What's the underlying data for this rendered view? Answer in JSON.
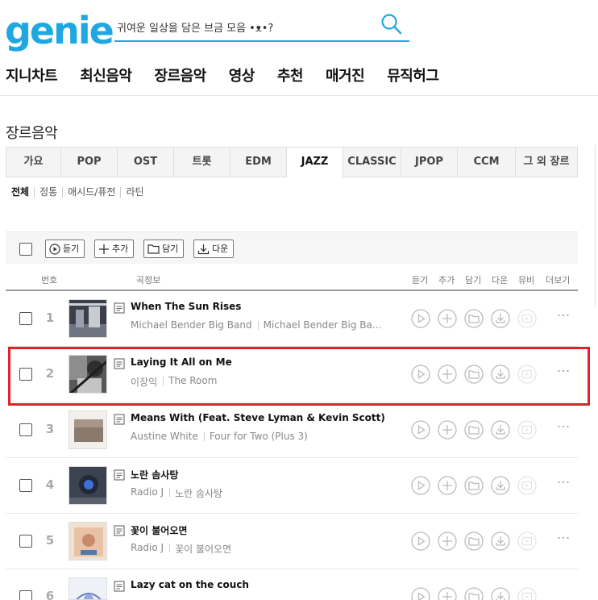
{
  "header": {
    "logo": "genie",
    "search_placeholder": "귀여운 일상을 담은 브금 모음 •ᴥ•?",
    "nav": [
      "지니차트",
      "최신음악",
      "장르음악",
      "영상",
      "추천",
      "매거진",
      "뮤직허그"
    ]
  },
  "page": {
    "title": "장르음악",
    "genre_tabs": [
      "가요",
      "POP",
      "OST",
      "트롯",
      "EDM",
      "JAZZ",
      "CLASSIC",
      "JPOP",
      "CCM",
      "그 외 장르"
    ],
    "active_tab": "JAZZ",
    "sub_tabs": [
      "전체",
      "정통",
      "애시드/퓨전",
      "라틴"
    ]
  },
  "toolbar": {
    "listen": "듣기",
    "add": "추가",
    "save": "담기",
    "download": "다운"
  },
  "list_header": {
    "no": "번호",
    "info": "곡정보",
    "listen": "듣기",
    "add": "추가",
    "save": "담기",
    "download": "다운",
    "mv": "뮤비",
    "more": "더보기"
  },
  "songs": [
    {
      "rank": "1",
      "title": "When The Sun Rises",
      "artist": "Michael Bender Big Band",
      "album": "Michael Bender Big Ban…"
    },
    {
      "rank": "2",
      "title": "Laying It All on Me",
      "artist": "이장익",
      "album": "The Room"
    },
    {
      "rank": "3",
      "title": "Means With (Feat. Steve Lyman & Kevin Scott)",
      "artist": "Austine White",
      "album": "Four for Two (Plus 3)"
    },
    {
      "rank": "4",
      "title": "노란 솜사탕",
      "artist": "Radio J",
      "album": "노란 솜사탕"
    },
    {
      "rank": "5",
      "title": "꽃이 불어오면",
      "artist": "Radio J",
      "album": "꽃이 불어오면"
    },
    {
      "rank": "6",
      "title": "Lazy cat on the couch",
      "artist": "",
      "album": ""
    }
  ],
  "colors": {
    "brand": "#1ea7e1",
    "highlight": "#e0222a"
  }
}
